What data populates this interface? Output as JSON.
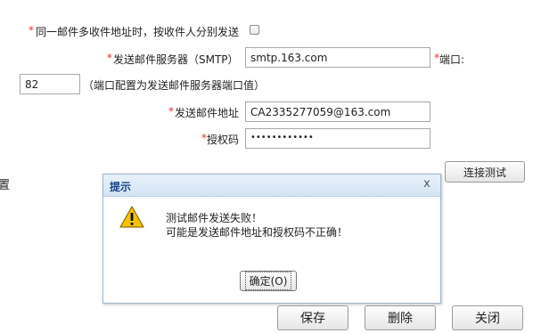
{
  "form": {
    "same_address_label": "同一邮件多收件地址时，按收件人分别发送",
    "smtp_server_label": "发送邮件服务器（SMTP）",
    "smtp_server_value": "smtp.163.com",
    "port_label": "端口:",
    "port_value": "82",
    "port_hint": "（端口配置为发送邮件服务器端口值）",
    "sender_address_label": "发送邮件地址",
    "sender_address_value": "CA2335277059@163.com",
    "auth_code_label": "授权码",
    "auth_code_value": "••••••••••••",
    "left_edge_fragment": "置",
    "required_mark": "*",
    "test_connection_button": "连接测试"
  },
  "dialog": {
    "title": "提示",
    "close_glyph": "x",
    "warning_glyph": "!",
    "message_line1": "测试邮件发送失败！",
    "message_line2": "可能是发送邮件地址和授权码不正确！",
    "ok_button_label": "确定(O)"
  },
  "footer": {
    "save_button": "保存",
    "delete_button": "删除",
    "close_button": "关闭"
  },
  "colors": {
    "required": "#e0312b",
    "dialog_title": "#15428b",
    "warning_fill": "#f5c400"
  }
}
